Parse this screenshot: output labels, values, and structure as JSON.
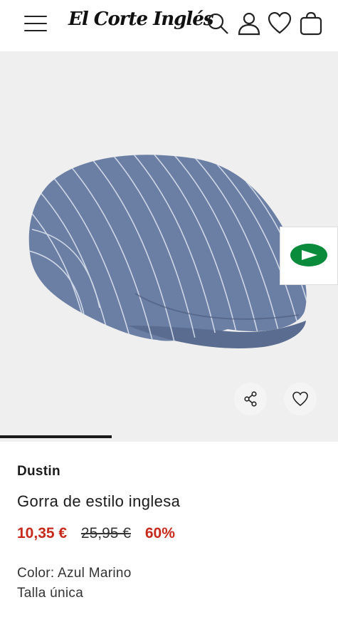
{
  "header": {
    "logo_text": "El Corte Inglés",
    "icons": [
      "menu-icon",
      "search-icon",
      "user-icon",
      "heart-icon",
      "shopping-bag-icon"
    ]
  },
  "gallery": {
    "image_alt": "Gorra de estilo inglesa",
    "slide_progress": 0.33
  },
  "product": {
    "brand": "Dustin",
    "title": "Gorra de estilo inglesa",
    "price_current": "10,35 €",
    "price_original": "25,95 €",
    "discount": "60%",
    "color": "Color: Azul Marino",
    "size": "Talla única"
  },
  "colors": {
    "price_red": "#c7291a",
    "ad_green": "#0a8a3b",
    "gallery_bg": "#efefef"
  }
}
